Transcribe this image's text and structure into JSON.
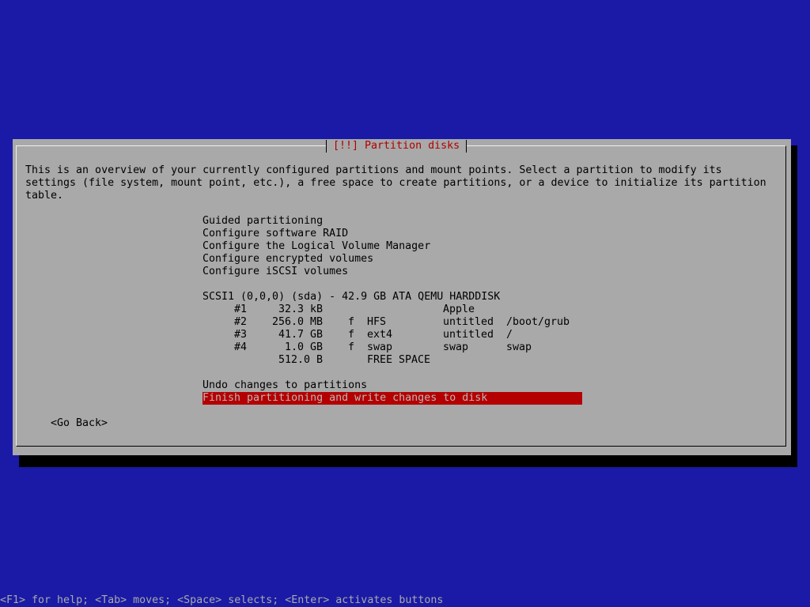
{
  "dialog": {
    "title": "[!!] Partition disks",
    "intro_lines": [
      "This is an overview of your currently configured partitions and mount points. Select a partition to modify its",
      "settings (file system, mount point, etc.), a free space to create partitions, or a device to initialize its partition",
      "table."
    ],
    "menu": [
      "Guided partitioning",
      "Configure software RAID",
      "Configure the Logical Volume Manager",
      "Configure encrypted volumes",
      "Configure iSCSI volumes"
    ],
    "disk_label": "SCSI1 (0,0,0) (sda) - 42.9 GB ATA QEMU HARDDISK",
    "partitions": [
      {
        "num": "#1",
        "size": "32.3 kB",
        "flag": "",
        "fs": "",
        "name": "Apple",
        "mount": ""
      },
      {
        "num": "#2",
        "size": "256.0 MB",
        "flag": "f",
        "fs": "HFS",
        "name": "untitled",
        "mount": "/boot/grub"
      },
      {
        "num": "#3",
        "size": "41.7 GB",
        "flag": "f",
        "fs": "ext4",
        "name": "untitled",
        "mount": "/"
      },
      {
        "num": "#4",
        "size": "1.0 GB",
        "flag": "f",
        "fs": "swap",
        "name": "swap",
        "mount": "swap"
      },
      {
        "num": "",
        "size": "512.0 B",
        "flag": "",
        "fs": "FREE SPACE",
        "name": "",
        "mount": ""
      }
    ],
    "undo_label": "Undo changes to partitions",
    "finish_label": "Finish partitioning and write changes to disk",
    "go_back_label": "<Go Back>"
  },
  "status_bar": "<F1> for help; <Tab> moves; <Space> selects; <Enter> activates buttons",
  "colors": {
    "background": "#1a1aa6",
    "dialog": "#a9a9a9",
    "title_text": "#b00000",
    "highlight": "#b40000"
  }
}
